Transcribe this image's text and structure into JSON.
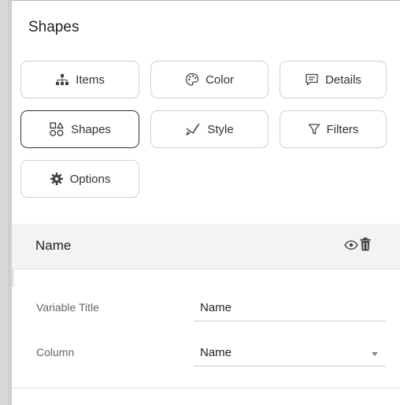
{
  "panel": {
    "title": "Shapes"
  },
  "tabs": [
    {
      "label": "Items",
      "icon": "hierarchy-icon",
      "active": false
    },
    {
      "label": "Color",
      "icon": "palette-icon",
      "active": false
    },
    {
      "label": "Details",
      "icon": "comment-icon",
      "active": false
    },
    {
      "label": "Shapes",
      "icon": "shapes-icon",
      "active": true
    },
    {
      "label": "Style",
      "icon": "brush-icon",
      "active": false
    },
    {
      "label": "Filters",
      "icon": "filter-icon",
      "active": false
    },
    {
      "label": "Options",
      "icon": "gear-icon",
      "active": false
    }
  ],
  "section": {
    "title": "Name",
    "icons": [
      "eye-icon",
      "trash-icon"
    ]
  },
  "fields": {
    "variable_title": {
      "label": "Variable Title",
      "value": "Name"
    },
    "column": {
      "label": "Column",
      "value": "Name"
    }
  },
  "colors": {
    "active_border": "#333333",
    "header_bg": "#f3f3f3",
    "rail": "#d7d7d7"
  }
}
